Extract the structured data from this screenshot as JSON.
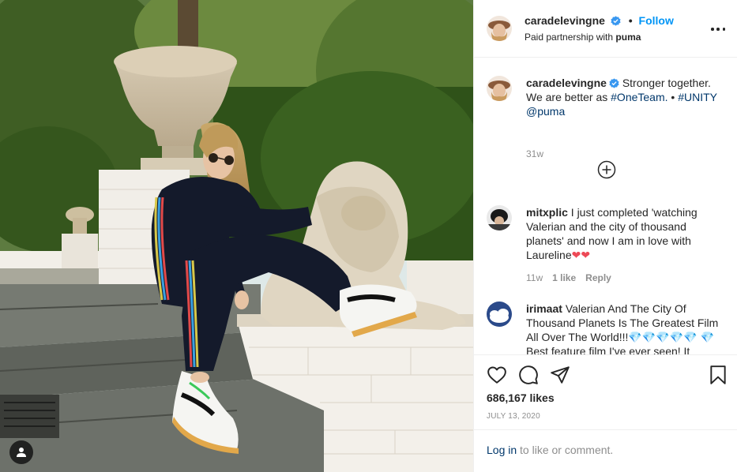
{
  "post": {
    "username": "caradelevingne",
    "separator": "•",
    "follow_label": "Follow",
    "partnership_prefix": "Paid partnership with",
    "partner": "puma",
    "caption": {
      "text_before": "Stronger together. We are better as",
      "hashtag1": "#OneTeam.",
      "separator": "•",
      "hashtag2": "#UNITY",
      "mention": "@puma"
    },
    "caption_age": "31w",
    "likes": "686,167 likes",
    "date": "JULY 13, 2020"
  },
  "comments": [
    {
      "username": "mitxplic",
      "text": "I just completed 'watching Valerian and the city of thousand planets' and now I am in love with Laureline",
      "emoji": "❤❤",
      "age": "11w",
      "likes": "1 like",
      "reply": "Reply"
    },
    {
      "username": "irimaat",
      "text": "Valerian And The City Of Thousand Planets Is The Greatest Film All Over The World!!!",
      "emoji": "💎💎💎💎💎",
      "text2": "💎 Best feature film I've ever seen! It"
    }
  ],
  "footer": {
    "login_link": "Log in",
    "login_suffix": " to like or comment."
  },
  "colors": {
    "follow_blue": "#0095f6",
    "link_blue": "#00376b",
    "heart_red": "#ed4956",
    "muted_gray": "#8e8e8e"
  }
}
